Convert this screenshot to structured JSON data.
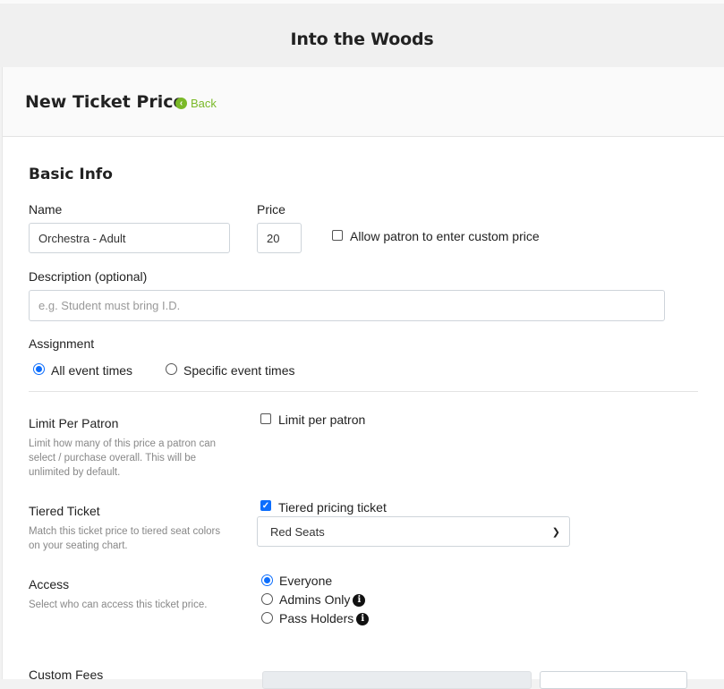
{
  "topbar": {
    "title": "Into the Woods"
  },
  "header": {
    "title": "New Ticket Price",
    "back_label": "Back"
  },
  "basic_info": {
    "section_title": "Basic Info",
    "name_label": "Name",
    "name_value": "Orchestra - Adult",
    "price_label": "Price",
    "price_value": "20",
    "custom_price_label": "Allow patron to enter custom price",
    "description_label": "Description (optional)",
    "description_placeholder": "e.g. Student must bring I.D.",
    "assignment_label": "Assignment",
    "assignment_options": [
      "All event times",
      "Specific event times"
    ],
    "assignment_selected": "All event times"
  },
  "limit": {
    "title": "Limit Per Patron",
    "help": "Limit how many of this price a patron can select / purchase overall. This will be unlimited by default.",
    "checkbox_label": "Limit per patron",
    "checked": false
  },
  "tiered": {
    "title": "Tiered Ticket",
    "help": "Match this ticket price to tiered seat colors on your seating chart.",
    "checkbox_label": "Tiered pricing ticket",
    "checked": true,
    "select_value": "Red Seats"
  },
  "access": {
    "title": "Access",
    "help": "Select who can access this ticket price.",
    "options": [
      "Everyone",
      "Admins Only",
      "Pass Holders"
    ],
    "selected": "Everyone"
  },
  "custom_fees": {
    "title": "Custom Fees"
  },
  "colors": {
    "accent_green": "#7ab928",
    "primary_blue": "#0d6efd"
  },
  "icons": {
    "back": "arrow-left-circle-icon",
    "info": "info-circle-icon",
    "select": "chevron-down-icon"
  }
}
